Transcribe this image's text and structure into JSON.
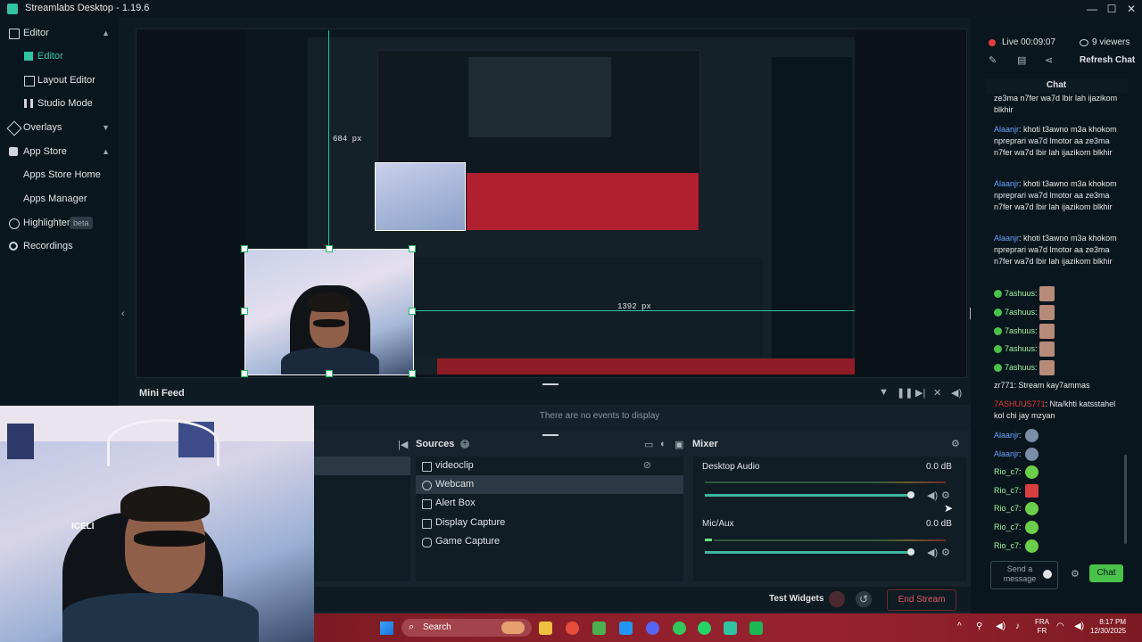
{
  "window": {
    "title": "Streamlabs Desktop - 1.19.6"
  },
  "nav": {
    "items": [
      {
        "label": "Editor",
        "type": "group"
      },
      {
        "label": "Editor",
        "type": "sub",
        "active": true
      },
      {
        "label": "Layout Editor",
        "type": "sub"
      },
      {
        "label": "Studio Mode",
        "type": "sub"
      },
      {
        "label": "Overlays",
        "type": "group"
      },
      {
        "label": "App Store",
        "type": "group"
      },
      {
        "label": "Apps Store Home",
        "type": "sub2"
      },
      {
        "label": "Apps Manager",
        "type": "sub2"
      },
      {
        "label": "Highlighter",
        "type": "group",
        "badge": "beta"
      },
      {
        "label": "Recordings",
        "type": "group"
      }
    ]
  },
  "preview": {
    "label_vertical": "684 px",
    "label_horizontal": "1392 px"
  },
  "live": {
    "status": "Live 00:09:07",
    "viewers": "9 viewers",
    "refresh": "Refresh Chat"
  },
  "chat": {
    "title": "Chat",
    "messages": [
      {
        "name": "",
        "text": "ze3ma n7fer wa7d lbir lah ijazikom blkhir"
      },
      {
        "name": "Alaanjr",
        "text": "khoti t3awno m3a khokom npreprari wa7d lmotor aa ze3ma n7fer wa7d lbir lah ijazikom blkhir"
      },
      {
        "name": "Alaanjr",
        "text": "khoti t3awno m3a khokom npreprari wa7d lmotor aa ze3ma n7fer wa7d lbir lah ijazikom blkhir"
      },
      {
        "name": "Alaanjr",
        "text": "khoti t3awno m3a khokom npreprari wa7d lmotor aa ze3ma n7fer wa7d lbir lah ijazikom blkhir"
      },
      {
        "name": "7ashuus",
        "text": ""
      },
      {
        "name": "7ashuus",
        "text": ""
      },
      {
        "name": "7ashuus",
        "text": ""
      },
      {
        "name": "7ashuus",
        "text": ""
      },
      {
        "name": "7ashuus",
        "text": ""
      },
      {
        "name": "zr771",
        "text": "Stream kay7ammas"
      },
      {
        "name": "7ASHUUS771",
        "text": "Nta/khti katsstahel kol chi jay mzyan"
      },
      {
        "name": "Alaanjr",
        "text": ""
      },
      {
        "name": "Alaanjr",
        "text": ""
      },
      {
        "name": "Rio_c7",
        "text": ""
      },
      {
        "name": "Rio_c7",
        "text": ""
      },
      {
        "name": "Rio_c7",
        "text": ""
      },
      {
        "name": "Rio_c7",
        "text": ""
      },
      {
        "name": "Rio_c7",
        "text": ""
      }
    ],
    "input_placeholder": "Send a message",
    "send_label": "Chat"
  },
  "minifeed": {
    "title": "Mini Feed",
    "empty": "There are no events to display"
  },
  "sources": {
    "title": "Sources",
    "items": [
      "videoclip",
      "Webcam",
      "Alert Box",
      "Display Capture",
      "Game Capture"
    ]
  },
  "mixer": {
    "title": "Mixer",
    "channels": [
      {
        "name": "Desktop Audio",
        "level": "0.0 dB"
      },
      {
        "name": "Mic/Aux",
        "level": "0.0 dB"
      }
    ]
  },
  "footer": {
    "test_widgets": "Test Widgets",
    "end_stream": "End Stream"
  },
  "taskbar": {
    "search": "Search",
    "lang": "FRA",
    "lang2": "FR",
    "time": "8:17 PM",
    "date": "12/30/2025"
  },
  "colors": {
    "accent": "#31c3a2",
    "live": "#e43b3b",
    "chat_send": "#49c24a"
  }
}
